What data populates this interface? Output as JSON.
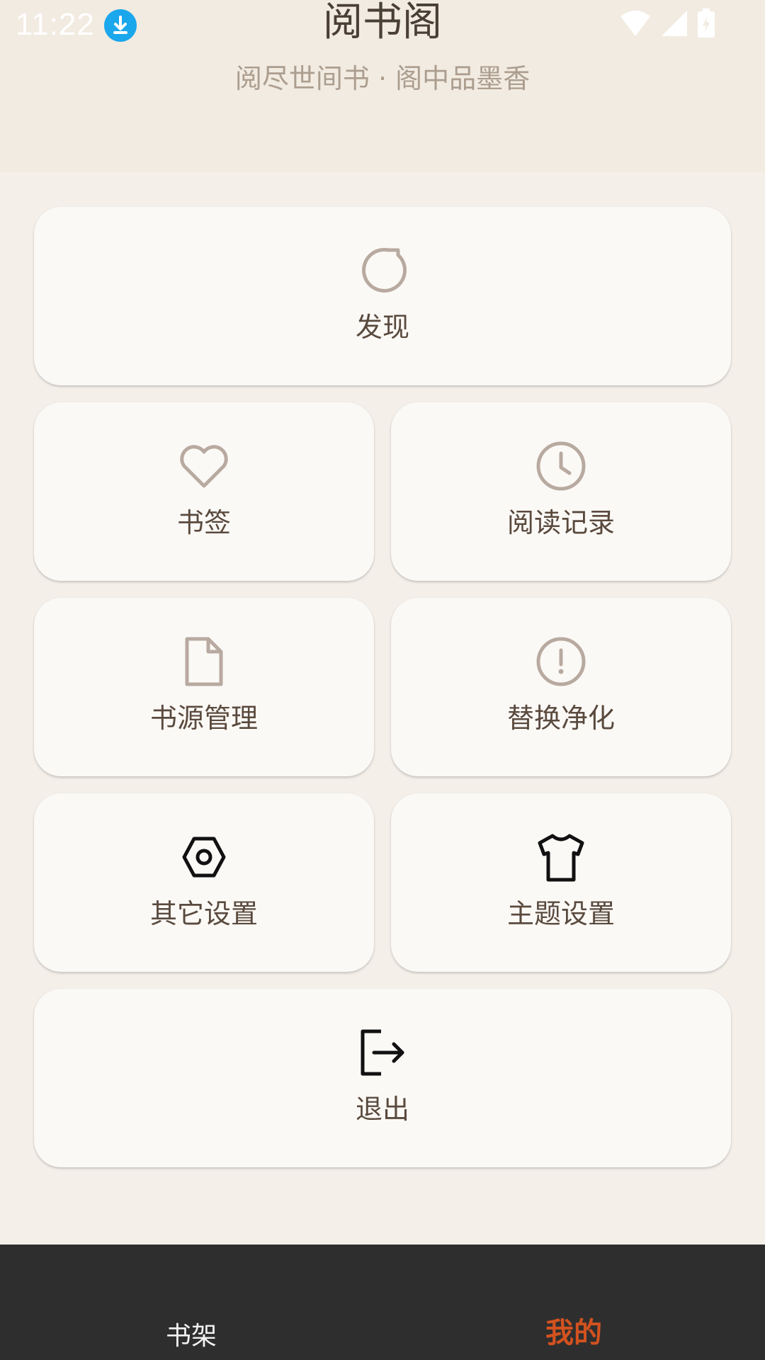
{
  "status_bar": {
    "time": "11:22",
    "icons": [
      "download-icon",
      "wifi-icon",
      "signal-icon",
      "battery-icon"
    ]
  },
  "header": {
    "title": "阅书阁",
    "subtitle": "阅尽世间书 · 阁中品墨香"
  },
  "menu": {
    "discover": {
      "label": "发现",
      "icon": "compass-icon"
    },
    "bookmarks": {
      "label": "书签",
      "icon": "heart-icon"
    },
    "history": {
      "label": "阅读记录",
      "icon": "clock-icon"
    },
    "book_sources": {
      "label": "书源管理",
      "icon": "file-icon"
    },
    "replace_clean": {
      "label": "替换净化",
      "icon": "alert-circle-icon"
    },
    "other_settings": {
      "label": "其它设置",
      "icon": "settings-nut-icon"
    },
    "theme_settings": {
      "label": "主题设置",
      "icon": "tshirt-icon"
    },
    "logout": {
      "label": "退出",
      "icon": "logout-icon"
    }
  },
  "bottom_nav": {
    "items": [
      {
        "label": "书架",
        "active": false
      },
      {
        "label": "我的",
        "active": true
      }
    ]
  },
  "colors": {
    "accent": "#d2521f",
    "header_bg": "#f2ebe1",
    "page_bg": "#f4efe9",
    "card_bg": "#fbf9f6",
    "icon_muted": "#b8aaa0",
    "nav_bg": "#2e2e2e"
  }
}
